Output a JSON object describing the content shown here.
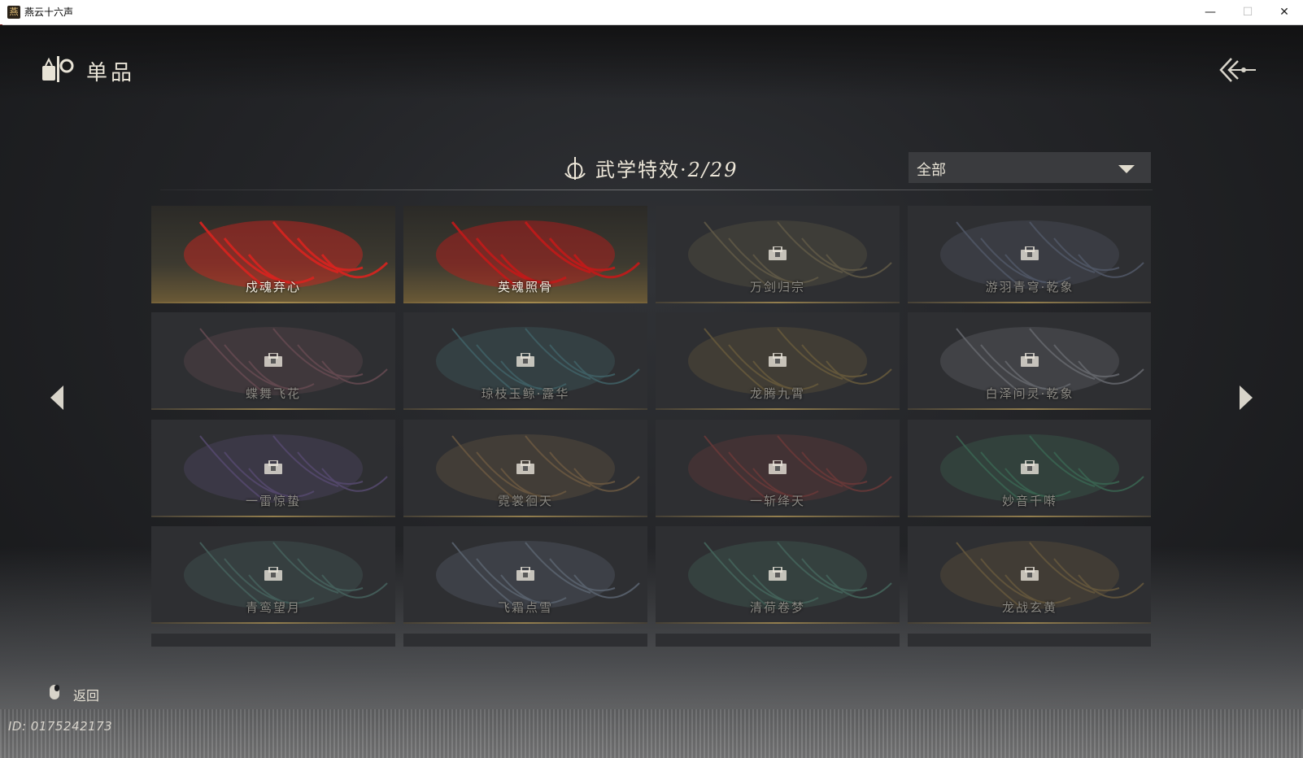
{
  "window": {
    "title": "燕云十六声",
    "minimize_glyph": "—",
    "maximize_glyph": "☐",
    "close_glyph": "✕"
  },
  "header": {
    "title": "单品",
    "icon": "shop-items-icon",
    "back_icon": "back-arrow-icon"
  },
  "section": {
    "title": "武学特效·",
    "count": "2/29",
    "icon": "lotus-emblem-icon"
  },
  "filter": {
    "value": "全部"
  },
  "cards": [
    {
      "name": "戍魂弃心",
      "locked": false,
      "palette": "#d8231f"
    },
    {
      "name": "英魂照骨",
      "locked": false,
      "palette": "#c21a1a"
    },
    {
      "name": "万剑归宗",
      "locked": true,
      "palette": "#b8a36a"
    },
    {
      "name": "游羽青穹·乾象",
      "locked": true,
      "palette": "#8ea0c4"
    },
    {
      "name": "蝶舞飞花",
      "locked": true,
      "palette": "#c77a88"
    },
    {
      "name": "琼枝玉鲸·露华",
      "locked": true,
      "palette": "#5fb9c2"
    },
    {
      "name": "龙腾九霄",
      "locked": true,
      "palette": "#c9a44e"
    },
    {
      "name": "白泽问灵·乾象",
      "locked": true,
      "palette": "#c8ccd6"
    },
    {
      "name": "一雷惊蛰",
      "locked": true,
      "palette": "#9b78d8"
    },
    {
      "name": "霓裳徊天",
      "locked": true,
      "palette": "#d6a25c"
    },
    {
      "name": "一斩绛天",
      "locked": true,
      "palette": "#d44a44"
    },
    {
      "name": "妙音千啭",
      "locked": true,
      "palette": "#4fc48a"
    },
    {
      "name": "青鸾望月",
      "locked": true,
      "palette": "#6fb8a8"
    },
    {
      "name": "飞霜点雪",
      "locked": true,
      "palette": "#a8c0dc"
    },
    {
      "name": "清荷卷梦",
      "locked": true,
      "palette": "#6bc4a4"
    },
    {
      "name": "龙战玄黄",
      "locked": true,
      "palette": "#c8a050"
    },
    {
      "name": "",
      "locked": true,
      "palette": "#c04a2a"
    },
    {
      "name": "",
      "locked": true,
      "palette": "#4a5cc0"
    },
    {
      "name": "",
      "locked": true,
      "palette": "#6aa048"
    },
    {
      "name": "",
      "locked": true,
      "palette": "#c02a2a"
    }
  ],
  "footer": {
    "back_label": "返回",
    "mouse_icon": "mouse-icon",
    "player_id": "ID: 0175242173"
  }
}
